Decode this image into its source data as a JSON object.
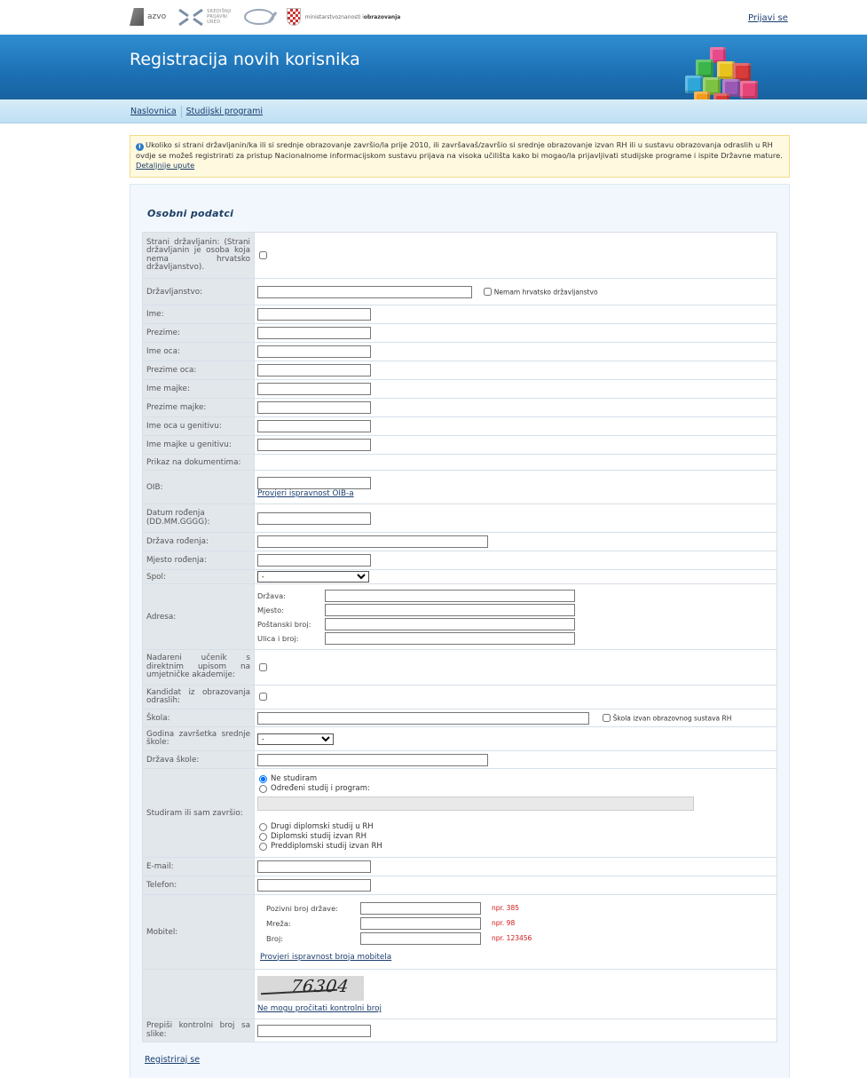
{
  "top": {
    "logos": {
      "azvo": "azvo",
      "sru": [
        "SREDIŠNJI",
        "PRIJAVNI",
        "URED"
      ],
      "ministry_prefix": "ministarstvo",
      "ministry_mid": "znanosti i",
      "ministry_suffix": "obrazovanja"
    },
    "login": "Prijavi se"
  },
  "banner": {
    "title": "Registracija novih korisnika"
  },
  "nav": [
    "Naslovnica",
    "Studijski programi"
  ],
  "notice": {
    "text": "Ukoliko si strani državljanin/ka ili si srednje obrazovanje završio/la prije 2010, ili završavaš/završio si srednje obrazovanje izvan RH ili u sustavu obrazovanja odraslih u RH ovdje se možeš registrirati za pristup Nacionalnome informacijskom sustavu prijava na visoka učilišta kako bi mogao/la prijavljivati studijske programe i ispite Državne mature. ",
    "link": "Detaljnije upute"
  },
  "form": {
    "section_title": "Osobni podatci",
    "labels": {
      "foreign": "Strani državljanin: (Strani državljanin je osoba koja nema hrvatsko državljanstvo).",
      "citizenship": "Državljanstvo:",
      "first_name": "Ime:",
      "last_name": "Prezime:",
      "father_name": "Ime oca:",
      "father_last_name": "Prezime oca:",
      "mother_name": "Ime majke:",
      "mother_last_name": "Prezime majke:",
      "father_gen": "Ime oca u genitivu:",
      "mother_gen": "Ime majke u genitivu:",
      "display": "Prikaz na dokumentima:",
      "oib": "OIB:",
      "birth_date": "Datum rođenja (DD.MM.GGGG):",
      "birth_country": "Država rođenja:",
      "birth_place": "Mjesto rođenja:",
      "gender": "Spol:",
      "address": "Adresa:",
      "talented": "Nadareni učenik s direktnim upisom na umjetničke akademije:",
      "adult_ed": "Kandidat iz obrazovanja odraslih:",
      "school": "Škola:",
      "grad_year": "Godina završetka srednje škole:",
      "school_country": "Država škole:",
      "studying": "Studiram ili sam završio:",
      "email": "E-mail:",
      "phone": "Telefon:",
      "mobile": "Mobitel:",
      "captcha_input": "Prepiši kontrolni broj sa slike:"
    },
    "no_citizenship": "Nemam hrvatsko državljanstvo",
    "oib_check": "Provjeri ispravnost OIB-a",
    "gender_selected": "-",
    "grad_year_selected": "-",
    "address": {
      "country": "Država:",
      "place": "Mjesto:",
      "postal": "Poštanski broj:",
      "street": "Ulica i broj:"
    },
    "school_outside": "Škola izvan obrazovnog sustava RH",
    "study_options": {
      "none": "Ne studiram",
      "specific": "Određeni studij i program:",
      "other_grad": "Drugi diplomski studij u RH",
      "grad_abroad": "Diplomski studij izvan RH",
      "undergrad_abroad": "Preddiplomski studij izvan RH"
    },
    "mobile": {
      "country_code": "Pozivni broj države:",
      "network": "Mreža:",
      "number": "Broj:",
      "hint_country": "npr. 385",
      "hint_network": "npr. 98",
      "hint_number": "npr. 123456",
      "check": "Provjeri ispravnost broja mobitela"
    },
    "captcha": {
      "text": "76304",
      "cant_read": "Ne mogu pročitati kontrolni broj"
    },
    "register": "Registriraj se"
  }
}
